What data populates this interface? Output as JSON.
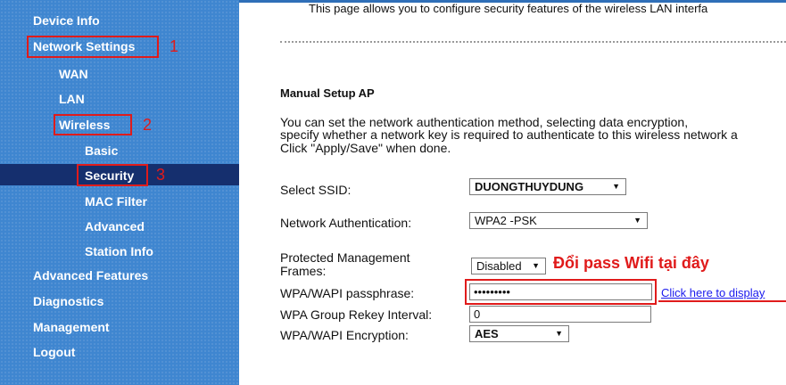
{
  "sidebar": {
    "items": {
      "device_info": "Device Info",
      "network_settings": "Network Settings",
      "wan": "WAN",
      "lan": "LAN",
      "wireless": "Wireless",
      "basic": "Basic",
      "security": "Security",
      "mac_filter": "MAC Filter",
      "advanced": "Advanced",
      "station_info": "Station Info",
      "advanced_features": "Advanced Features",
      "diagnostics": "Diagnostics",
      "management": "Management",
      "logout": "Logout"
    },
    "step_numbers": [
      "1",
      "2",
      "3"
    ],
    "annotation_color": "#e01b1b",
    "background_color": "#3f86d0",
    "selected_color": "#152f6e"
  },
  "main": {
    "intro_text": "This page allows you to configure security features of the wireless LAN interfa",
    "section_title": "Manual Setup AP",
    "description": [
      "You can set the network authentication method, selecting data encryption,",
      "specify whether a network key is required to authenticate to this wireless network a",
      "Click \"Apply/Save\" when done."
    ],
    "fields": {
      "ssid_label": "Select SSID:",
      "ssid_value": "DUONGTHUYDUNG",
      "auth_label": "Network Authentication:",
      "auth_value": "WPA2 -PSK",
      "pmf_label_line1": "Protected Management",
      "pmf_label_line2": "Frames:",
      "pmf_value": "Disabled",
      "passphrase_label": "WPA/WAPI passphrase:",
      "passphrase_value": "•••••••••",
      "rekey_label": "WPA Group Rekey Interval:",
      "rekey_value": "0",
      "encryption_label": "WPA/WAPI Encryption:",
      "encryption_value": "AES"
    },
    "display_link": "Click here to display",
    "annotation": "Đổi pass Wifi tại đây"
  }
}
